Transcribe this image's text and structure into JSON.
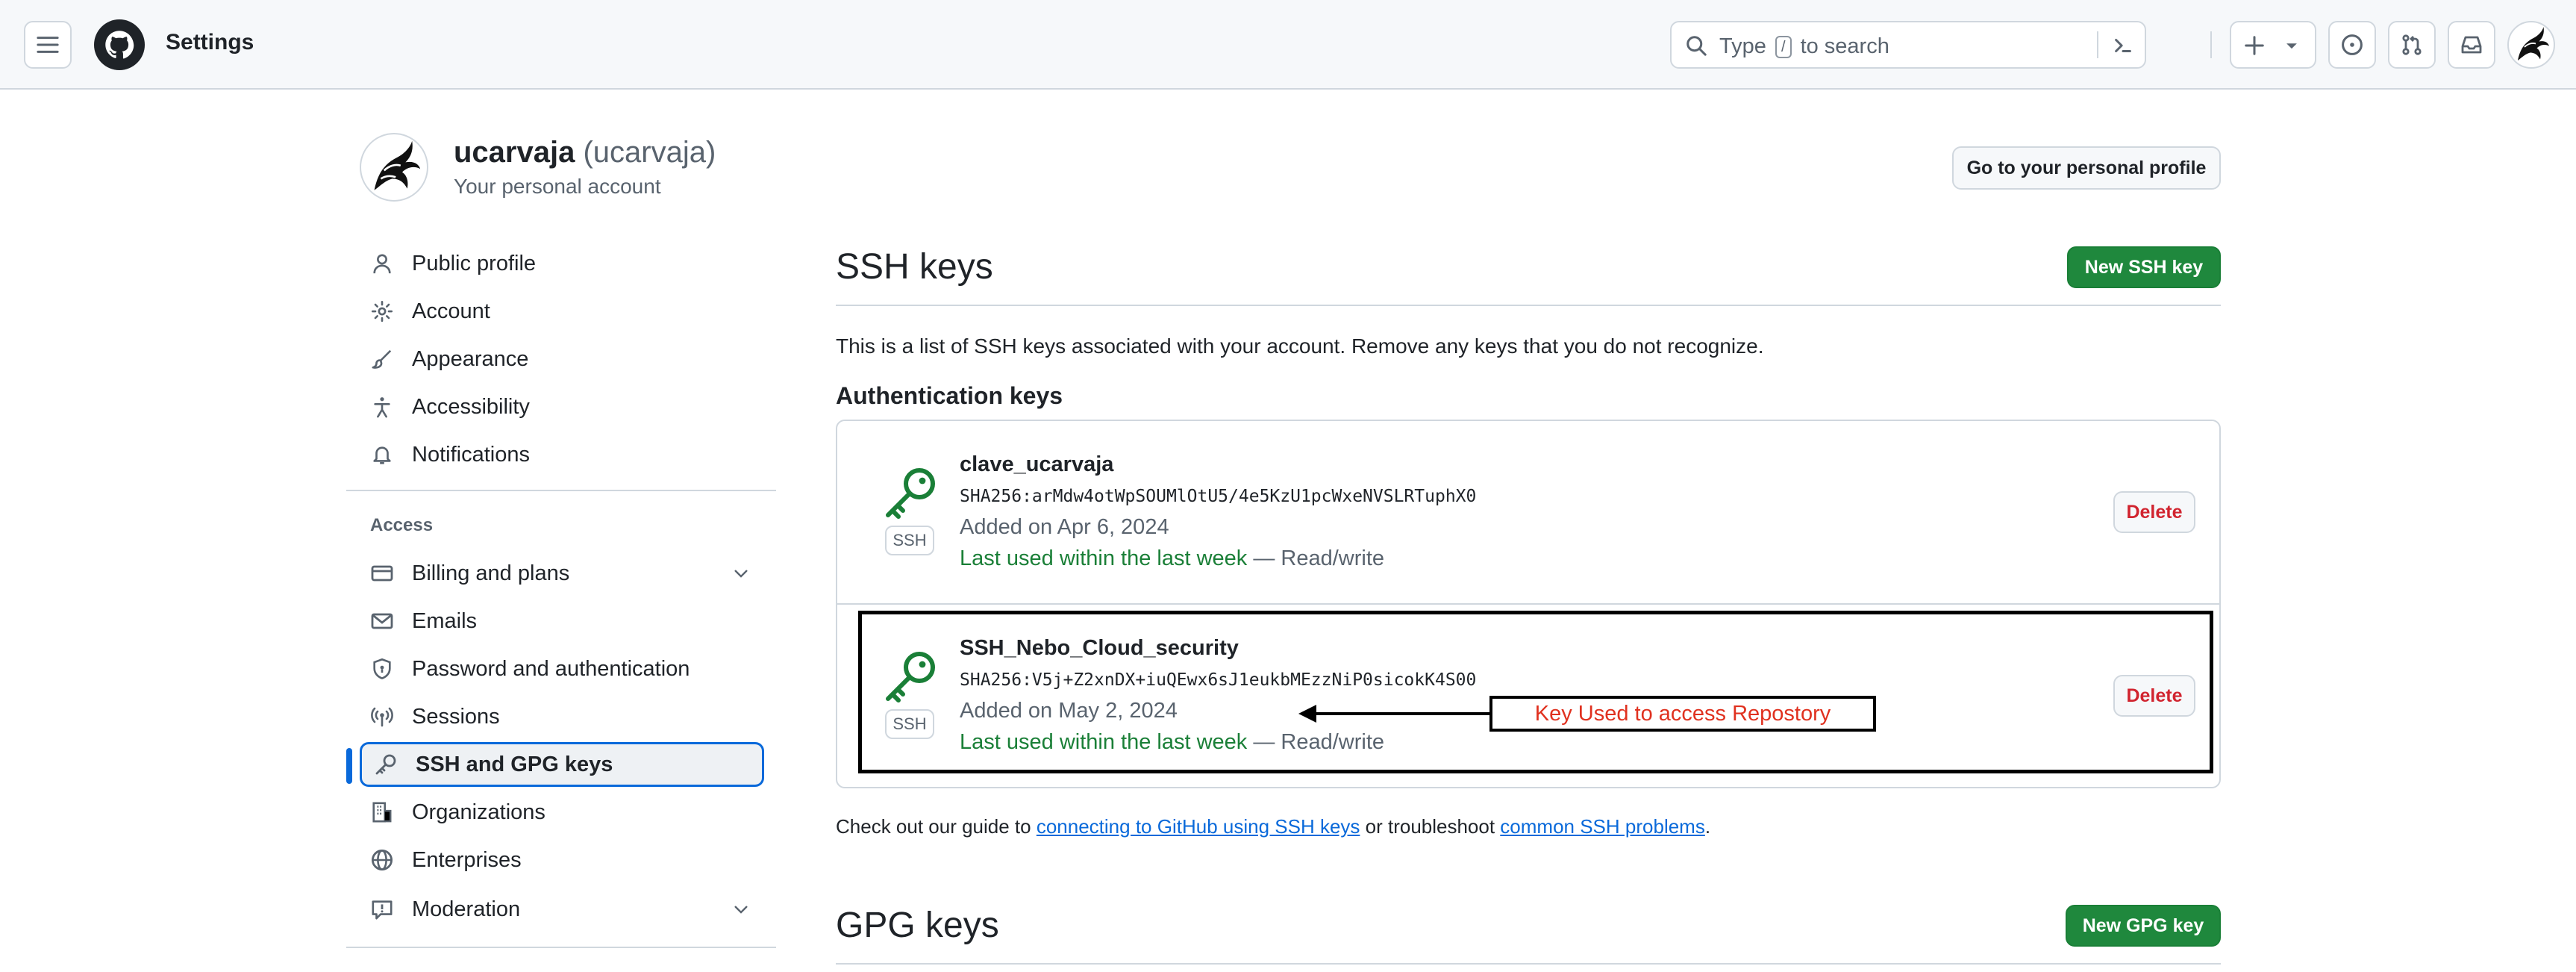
{
  "header": {
    "title": "Settings",
    "search_prefix": "Type",
    "search_key": "/",
    "search_suffix": "to search"
  },
  "profile": {
    "name": "ucarvaja",
    "handle": "(ucarvaja)",
    "subtitle": "Your personal account",
    "go_profile_label": "Go to your personal profile"
  },
  "sidebar": {
    "items": [
      {
        "label": "Public profile"
      },
      {
        "label": "Account"
      },
      {
        "label": "Appearance"
      },
      {
        "label": "Accessibility"
      },
      {
        "label": "Notifications"
      }
    ],
    "access_heading": "Access",
    "access_items": [
      {
        "label": "Billing and plans"
      },
      {
        "label": "Emails"
      },
      {
        "label": "Password and authentication"
      },
      {
        "label": "Sessions"
      },
      {
        "label": "SSH and GPG keys"
      },
      {
        "label": "Organizations"
      },
      {
        "label": "Enterprises"
      },
      {
        "label": "Moderation"
      }
    ]
  },
  "ssh": {
    "heading": "SSH keys",
    "new_label": "New SSH key",
    "description": "This is a list of SSH keys associated with your account. Remove any keys that you do not recognize.",
    "auth_heading": "Authentication keys",
    "keys": [
      {
        "badge": "SSH",
        "title": "clave_ucarvaja",
        "fingerprint": "SHA256:arMdw4otWpSOUMlOtU5/4e5KzU1pcWxeNVSLRTuphX0",
        "added": "Added on Apr 6, 2024",
        "last_used": "Last used within the last week",
        "access": " — Read/write",
        "delete_label": "Delete"
      },
      {
        "badge": "SSH",
        "title": "SSH_Nebo_Cloud_security",
        "fingerprint": "SHA256:V5j+Z2xnDX+iuQEwx6sJ1eukbMEzzNiP0sicokK4S00",
        "added": "Added on May 2, 2024",
        "last_used": "Last used within the last week",
        "access": " — Read/write",
        "delete_label": "Delete"
      }
    ],
    "annotation": "Key Used to access Repostory",
    "guide_prefix": "Check out our guide to ",
    "guide_link1": "connecting to GitHub using SSH keys",
    "guide_mid": " or troubleshoot ",
    "guide_link2": "common SSH problems",
    "guide_end": "."
  },
  "gpg": {
    "heading": "GPG keys",
    "new_label": "New GPG key"
  },
  "colors": {
    "accent": "#0969da",
    "success": "#1a7f37",
    "primary_button": "#1f883d",
    "danger": "#d1242f",
    "annotation_text": "#e0311f"
  }
}
